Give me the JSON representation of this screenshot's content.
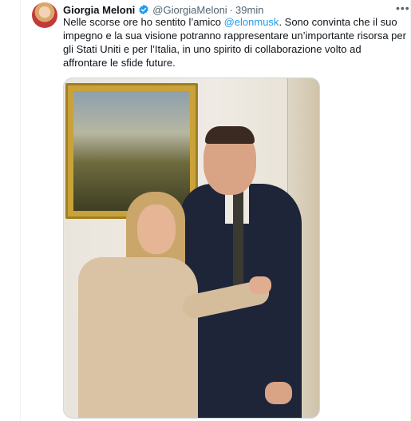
{
  "tweet": {
    "author_name": "Giorgia Meloni",
    "handle": "@GiorgiaMeloni",
    "separator": "·",
    "time": "39min",
    "more_icon": "more-horizontal-icon",
    "text_before": "Nelle scorse ore ho sentito l’amico ",
    "mention": "@elonmusk",
    "text_after": ". Sono convinta che il suo impegno e la sua visione potranno rappresentare un’importante risorsa per gli Stati Uniti e per l’Italia, in uno spirito di collaborazione volto ad affrontare le sfide future."
  },
  "colors": {
    "verified_badge": "#1d9bf0",
    "mention": "#1d9bf0",
    "secondary_text": "#536471",
    "border": "#cfd9de"
  },
  "icons": {
    "verified": "verified-badge-icon",
    "more": "more-horizontal-icon"
  }
}
